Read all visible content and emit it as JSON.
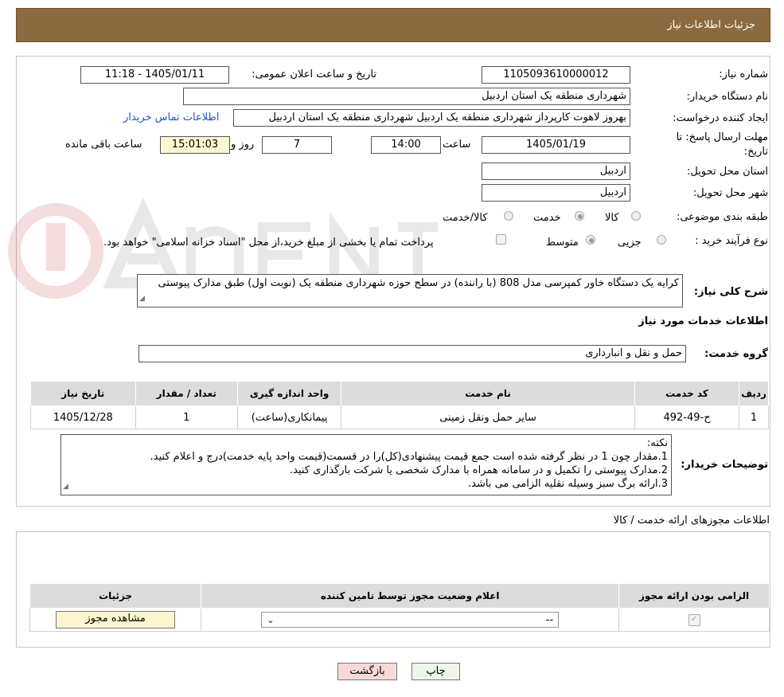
{
  "header": {
    "title": "جزئیات اطلاعات نیاز"
  },
  "form": {
    "need_number_label": "شماره نیاز:",
    "need_number": "1105093610000012",
    "announce_label": "تاریخ و ساعت اعلان عمومی:",
    "announce_value": "1405/01/11 - 11:18",
    "buyer_label": "نام دستگاه خریدار:",
    "buyer_value": "شهرداری منطقه یک استان اردبیل",
    "creator_label": "ایجاد کننده درخواست:",
    "creator_value": "بهروز لاهوت کارپرداز شهرداری منطقه یک اردبیل شهرداری منطقه یک استان اردبیل",
    "contact_link": "اطلاعات تماس خریدار",
    "deadline_label": "مهلت ارسال پاسخ: تا تاریخ:",
    "deadline_date": "1405/01/19",
    "time_label": "ساعت",
    "deadline_time": "14:00",
    "days_value": "7",
    "days_label": "روز و",
    "remaining_time": "15:01:03",
    "remaining_label": "ساعت باقی مانده",
    "province_label": "استان محل تحویل:",
    "province_value": "اردبیل",
    "city_label": "شهر محل تحویل:",
    "city_value": "اردبیل",
    "category_label": "طبقه بندی موضوعی:",
    "category_options": [
      "کالا",
      "خدمت",
      "کالا/خدمت"
    ],
    "process_label": "نوع فرآیند خرید :",
    "process_options": [
      "جزیی",
      "متوسط"
    ],
    "payment_note": "پرداخت تمام یا بخشی از مبلغ خرید،از محل \"اسناد خزانه اسلامی\" خواهد بود.",
    "desc_label": "شرح کلی نیاز:",
    "desc_value": "کرایه یک دستگاه خاور کمپرسی مدل 808 (با راننده) در سطح حوزه شهرداری منطقه یک (نوبت اول) طبق مدارک پیوستی",
    "services_title": "اطلاعات خدمات مورد نیاز",
    "service_group_label": "گروه خدمت:",
    "service_group_value": "حمل و نقل و انبارداری"
  },
  "services_table": {
    "headers": [
      "ردیف",
      "کد خدمت",
      "نام خدمت",
      "واحد اندازه گیری",
      "تعداد / مقدار",
      "تاریخ نیاز"
    ],
    "rows": [
      [
        "1",
        "ح-49-492",
        "سایر حمل ونقل زمینی",
        "پیمانکاری(ساعت)",
        "1",
        "1405/12/28"
      ]
    ]
  },
  "buyer_notes": {
    "label": "توضیحات خریدار:",
    "lines": [
      "نکته:",
      "1.مقدار چون 1 در نظر گرفته شده است جمع قیمت پیشنهادی(کل)را در قسمت(قیمت واحد پایه خدمت)درج و اعلام کنید.",
      "2.مدارک پیوستی را تکمیل و در سامانه همراه با مدارک شخصی یا شرکت بارگذاری کنید.",
      "3.ارائه برگ سبز وسیله نقلیه الزامی می باشد."
    ]
  },
  "permits": {
    "title": "اطلاعات مجوزهای ارائه خدمت / کالا",
    "headers": [
      "الزامی بودن ارائه مجوز",
      "اعلام وضعیت مجوز توسط تامین کننده",
      "جزئیات"
    ],
    "select_value": "--",
    "view_button": "مشاهده مجوز"
  },
  "buttons": {
    "print": "چاپ",
    "back": "بازگشت"
  },
  "colors": {
    "header_bg": "#8b6a3f",
    "link": "#1a56c4",
    "back_btn": "#f8d8d8",
    "print_btn": "#eef8e6"
  }
}
